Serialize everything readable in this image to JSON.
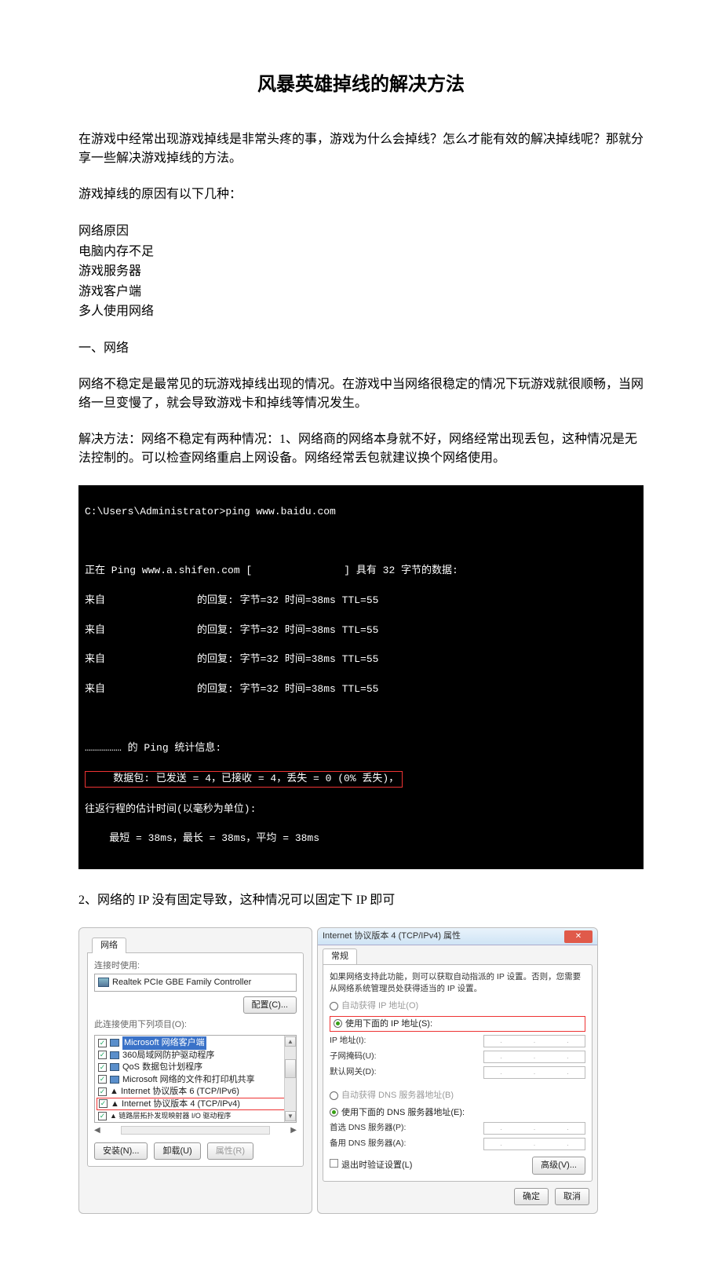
{
  "doc": {
    "title": "风暴英雄掉线的解决方法",
    "intro": "在游戏中经常出现游戏掉线是非常头疼的事，游戏为什么会掉线？怎么才能有效的解决掉线呢？那就分享一些解决游戏掉线的方法。",
    "reasons_label": "游戏掉线的原因有以下几种：",
    "reasons": [
      "网络原因",
      "电脑内存不足",
      "游戏服务器",
      "游戏客户端",
      "多人使用网络"
    ],
    "sec1_label": "一、网络",
    "sec1_p1": "网络不稳定是最常见的玩游戏掉线出现的情况。在游戏中当网络很稳定的情况下玩游戏就很顺畅，当网络一旦变慢了，就会导致游戏卡和掉线等情况发生。",
    "sec1_p2": "解决方法：网络不稳定有两种情况：1、网络商的网络本身就不好，网络经常出现丢包，这种情况是无法控制的。可以检查网络重启上网设备。网络经常丢包就建议换个网络使用。",
    "sec1_p3": "2、网络的 IP 没有固定导致，这种情况可以固定下 IP 即可"
  },
  "terminal": {
    "prompt": "C:\\Users\\Administrator>ping www.baidu.com",
    "l1": "正在 Ping www.a.shifen.com [               ] 具有 32 字节的数据:",
    "l2": "来自               的回复: 字节=32 时间=38ms TTL=55",
    "l3": "来自               的回复: 字节=32 时间=38ms TTL=55",
    "l4": "来自               的回复: 字节=32 时间=38ms TTL=55",
    "l5": "来自               的回复: 字节=32 时间=38ms TTL=55",
    "stats_header": "……………… 的 Ping 统计信息:",
    "stats_hl": "    数据包: 已发送 = 4，已接收 = 4，丢失 = 0 (0% 丢失)，",
    "rtt1": "往返行程的估计时间(以毫秒为单位):",
    "rtt2": "    最短 = 38ms，最长 = 38ms，平均 = 38ms"
  },
  "net_dlg": {
    "tab": "网络",
    "connect_using": "连接时使用:",
    "adapter": "Realtek PCIe GBE Family Controller",
    "configure": "配置(C)...",
    "items_label": "此连接使用下列项目(O):",
    "items": [
      "Microsoft 网络客户端",
      "360局域网防护驱动程序",
      "QoS 数据包计划程序",
      "Microsoft 网络的文件和打印机共享",
      "▲ Internet 协议版本 6 (TCP/IPv6)",
      "▲ Internet 协议版本 4 (TCP/IPv4)",
      "▲ 链路层拓扑发现映射器 I/O 驱动程序"
    ],
    "install": "安装(N)...",
    "uninstall": "卸载(U)",
    "properties": "属性(R)"
  },
  "ipv4_dlg": {
    "title": "Internet 协议版本 4 (TCP/IPv4) 属性",
    "tab": "常规",
    "desc": "如果网络支持此功能，则可以获取自动指派的 IP 设置。否则，您需要从网络系统管理员处获得适当的 IP 设置。",
    "r_auto_ip": "自动获得 IP 地址(O)",
    "r_use_ip": "使用下面的 IP 地址(S):",
    "ip_addr": "IP 地址(I):",
    "subnet": "子网掩码(U):",
    "gateway": "默认网关(D):",
    "r_auto_dns": "自动获得 DNS 服务器地址(B)",
    "r_use_dns": "使用下面的 DNS 服务器地址(E):",
    "dns1": "首选 DNS 服务器(P):",
    "dns2": "备用 DNS 服务器(A):",
    "validate": "退出时验证设置(L)",
    "advanced": "高级(V)...",
    "ok": "确定",
    "cancel": "取消"
  }
}
